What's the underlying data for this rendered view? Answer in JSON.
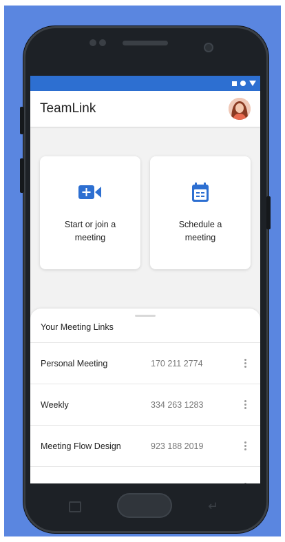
{
  "app": {
    "title": "TeamLink",
    "accent_color": "#2d6fd1"
  },
  "status_bar": {
    "icons": [
      "square-icon",
      "circle-icon",
      "triangle-icon"
    ]
  },
  "actions": [
    {
      "label": "Start or join a meeting",
      "icon": "video-plus-icon"
    },
    {
      "label": "Schedule a meeting",
      "icon": "calendar-icon"
    }
  ],
  "meeting_links": {
    "title": "Your Meeting Links",
    "items": [
      {
        "name": "Personal Meeting",
        "number": "170 211 2774"
      },
      {
        "name": "Weekly",
        "number": "334 263 1283"
      },
      {
        "name": "Meeting Flow Design",
        "number": "923 188 2019"
      }
    ]
  }
}
